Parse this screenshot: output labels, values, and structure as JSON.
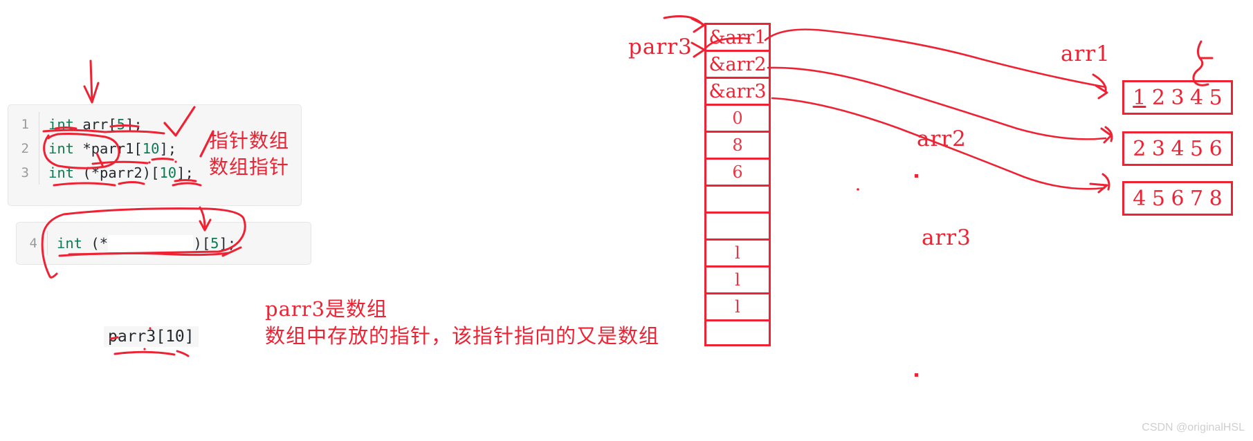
{
  "code_main": {
    "lines": [
      {
        "num": "1",
        "parts": [
          {
            "t": "int",
            "c": "kw"
          },
          {
            "t": " arr[",
            "c": "pun"
          },
          {
            "t": "5",
            "c": "num"
          },
          {
            "t": "];",
            "c": "pun"
          }
        ]
      },
      {
        "num": "2",
        "parts": [
          {
            "t": "int",
            "c": "kw"
          },
          {
            "t": " *parr1[",
            "c": "pun"
          },
          {
            "t": "10",
            "c": "num"
          },
          {
            "t": "];",
            "c": "pun"
          }
        ]
      },
      {
        "num": "3",
        "parts": [
          {
            "t": "int",
            "c": "kw"
          },
          {
            "t": " (*parr2)[",
            "c": "pun"
          },
          {
            "t": "10",
            "c": "num"
          },
          {
            "t": "];",
            "c": "pun"
          }
        ]
      }
    ]
  },
  "code_second": {
    "lines": [
      {
        "num": "4",
        "parts": [
          {
            "t": "int",
            "c": "kw"
          },
          {
            "t": " (*",
            "c": "pun"
          },
          {
            "t": "          ",
            "c": "pun"
          },
          {
            "t": ")[",
            "c": "pun"
          },
          {
            "t": "5",
            "c": "num"
          },
          {
            "t": "];",
            "c": "pun"
          }
        ]
      }
    ]
  },
  "annotations": {
    "pointer_array": "指针数组",
    "array_pointer": "数组指针",
    "parr3_bracket": "parr3[10]",
    "note_line1": "parr3是数组",
    "note_line2": "数组中存放的指针，该指针指向的又是数组"
  },
  "diagram": {
    "parr3_label": "parr3",
    "arr1_label": "arr1",
    "arr2_label": "arr2",
    "arr3_label": "arr3",
    "memory_cells": [
      {
        "text": "&arr1",
        "kind": "value"
      },
      {
        "text": "&arr2",
        "kind": "value"
      },
      {
        "text": "&arr3",
        "kind": "value"
      },
      {
        "text": "0",
        "kind": "scribble"
      },
      {
        "text": "8",
        "kind": "scribble"
      },
      {
        "text": "6",
        "kind": "scribble"
      },
      {
        "text": "",
        "kind": "empty"
      },
      {
        "text": "",
        "kind": "empty"
      },
      {
        "text": "l",
        "kind": "scribble"
      },
      {
        "text": "l",
        "kind": "scribble"
      },
      {
        "text": "l",
        "kind": "scribble"
      },
      {
        "text": "",
        "kind": "empty"
      }
    ],
    "arrays": [
      {
        "name": "arr1",
        "values": [
          "1",
          "2",
          "3",
          "4",
          "5"
        ],
        "underline_index": 0
      },
      {
        "name": "arr2",
        "values": [
          "2",
          "3",
          "4",
          "5",
          "6"
        ],
        "underline_index": -1
      },
      {
        "name": "arr3",
        "values": [
          "4",
          "5",
          "6",
          "7",
          "8"
        ],
        "underline_index": -1
      }
    ]
  },
  "colors": {
    "ink_red": "#ee2233",
    "code_keyword": "#0f7b52",
    "code_number": "#0b7a54",
    "code_text": "#24292e",
    "code_bg": "#f6f6f6"
  },
  "watermark": "CSDN @originalHSL"
}
